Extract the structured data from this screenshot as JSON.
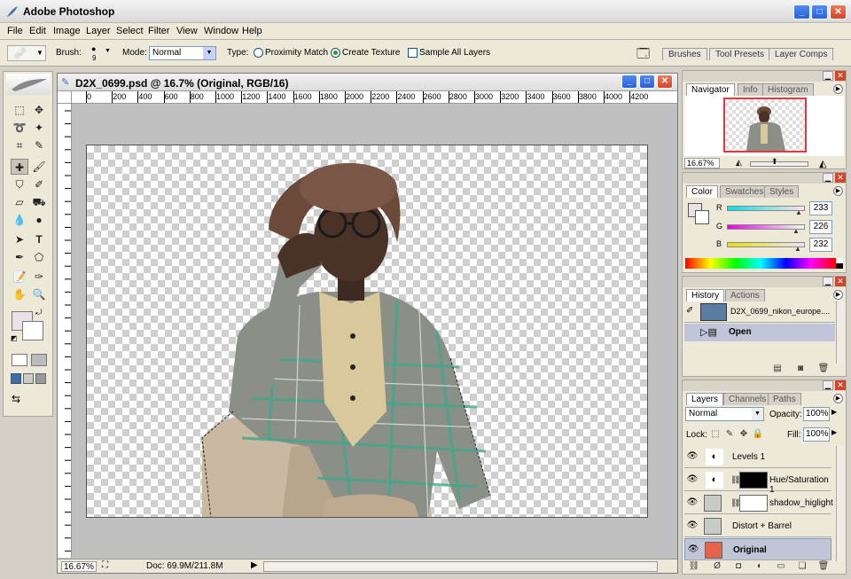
{
  "app": {
    "title": "Adobe Photoshop"
  },
  "menu": [
    "File",
    "Edit",
    "Image",
    "Layer",
    "Select",
    "Filter",
    "View",
    "Window",
    "Help"
  ],
  "options": {
    "brush_label": "Brush:",
    "brush_size": "9",
    "mode_label": "Mode:",
    "mode_value": "Normal",
    "type_label": "Type:",
    "proximity": "Proximity Match",
    "create_texture": "Create Texture",
    "sample_all": "Sample All Layers"
  },
  "palette_well": [
    "Brushes",
    "Tool Presets",
    "Layer Comps"
  ],
  "document": {
    "title": "D2X_0699.psd @ 16.7% (Original, RGB/16)",
    "ruler": [
      "0",
      "200",
      "400",
      "600",
      "800",
      "1000",
      "1200",
      "1400",
      "1600",
      "1800",
      "2000",
      "2200",
      "2400",
      "2600",
      "2800",
      "3000",
      "3200",
      "3400",
      "3600",
      "3800",
      "4000",
      "4200"
    ],
    "zoom": "16.67%",
    "doc_info": "Doc: 69.9M/211.8M"
  },
  "navigator": {
    "tabs": [
      "Navigator",
      "Info",
      "Histogram"
    ],
    "zoom": "16.67%"
  },
  "color": {
    "tabs": [
      "Color",
      "Swatches",
      "Styles"
    ],
    "r_label": "R",
    "g_label": "G",
    "b_label": "B",
    "r": "233",
    "g": "226",
    "b": "232"
  },
  "history": {
    "tabs": [
      "History",
      "Actions"
    ],
    "snapshot": "D2X_0699_nikon_europe....",
    "step": "Open"
  },
  "layers": {
    "tabs": [
      "Layers",
      "Channels",
      "Paths"
    ],
    "blend": "Normal",
    "opacity_label": "Opacity:",
    "opacity": "100%",
    "lock_label": "Lock:",
    "fill_label": "Fill:",
    "fill": "100%",
    "items": [
      {
        "name": "Levels 1"
      },
      {
        "name": "Hue/Saturation 1"
      },
      {
        "name": "shadow_higlight"
      },
      {
        "name": "Distort + Barrel"
      },
      {
        "name": "Original"
      }
    ]
  }
}
